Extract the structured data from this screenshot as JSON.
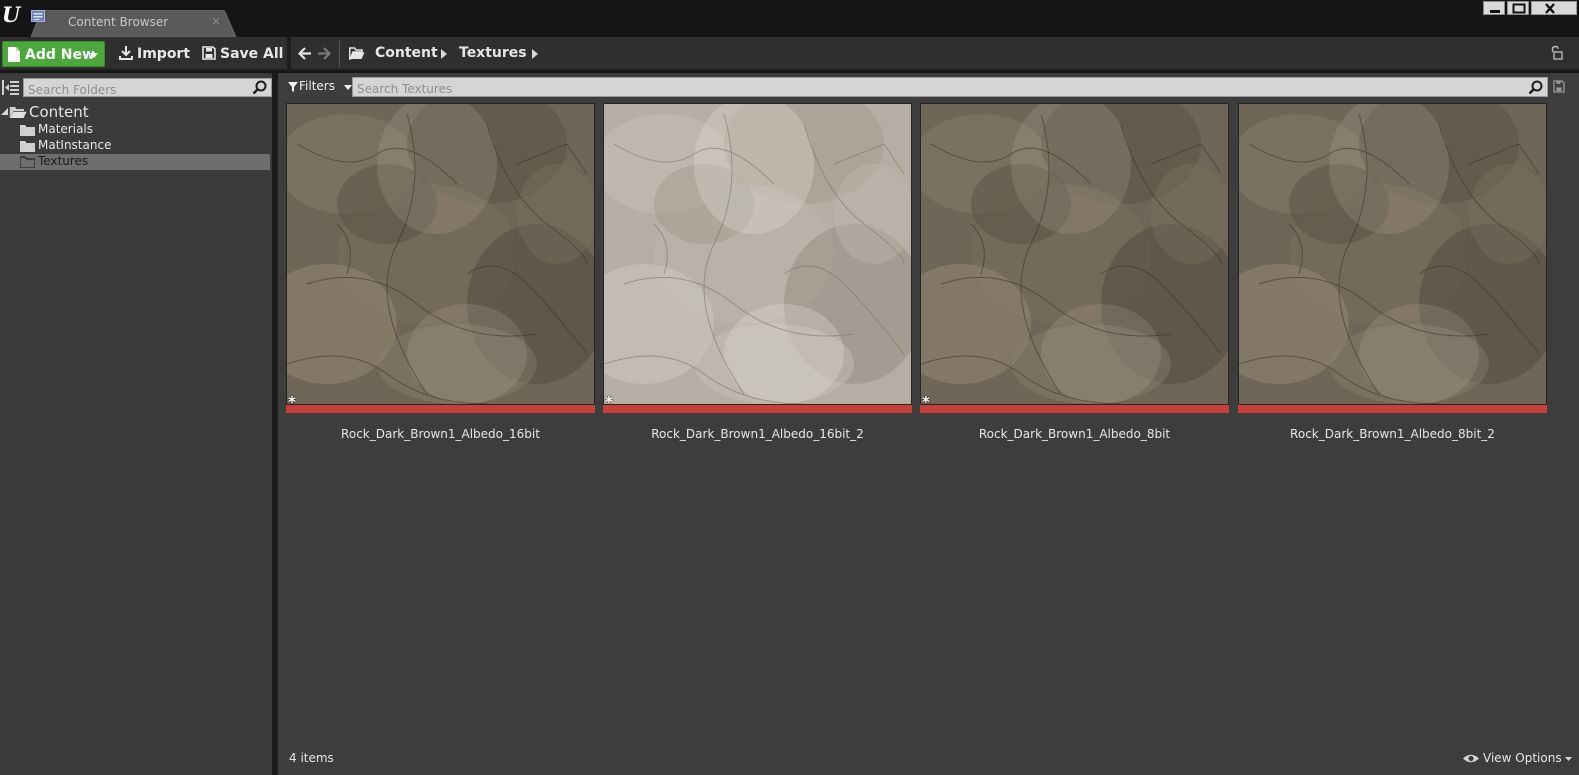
{
  "window": {
    "logo": "U",
    "tab_label": "Content Browser",
    "tab_close": "×"
  },
  "toolbar": {
    "add_new_label": "Add New",
    "import_label": "Import",
    "save_all_label": "Save All",
    "breadcrumb": [
      "Content",
      "Textures"
    ]
  },
  "sources": {
    "search_placeholder": "Search Folders",
    "tree": [
      {
        "label": "Content",
        "expanded": true
      },
      {
        "label": "Materials"
      },
      {
        "label": "MatInstance"
      },
      {
        "label": "Textures",
        "selected": true
      }
    ]
  },
  "assets": {
    "filters_label": "Filters",
    "search_placeholder": "Search Textures",
    "items": [
      {
        "name": "Rock_Dark_Brown1_Albedo_16bit",
        "tone": "dark",
        "mark": "*"
      },
      {
        "name": "Rock_Dark_Brown1_Albedo_16bit_2",
        "tone": "light",
        "mark": "*"
      },
      {
        "name": "Rock_Dark_Brown1_Albedo_8bit",
        "tone": "dark",
        "mark": "*"
      },
      {
        "name": "Rock_Dark_Brown1_Albedo_8bit_2",
        "tone": "dark",
        "mark": ""
      }
    ],
    "item_count": "4 items",
    "view_options_label": "View Options"
  },
  "colors": {
    "add_new": "#4ca83a",
    "texture_bar": "#c63f3b",
    "panel": "#3d3d3d"
  }
}
